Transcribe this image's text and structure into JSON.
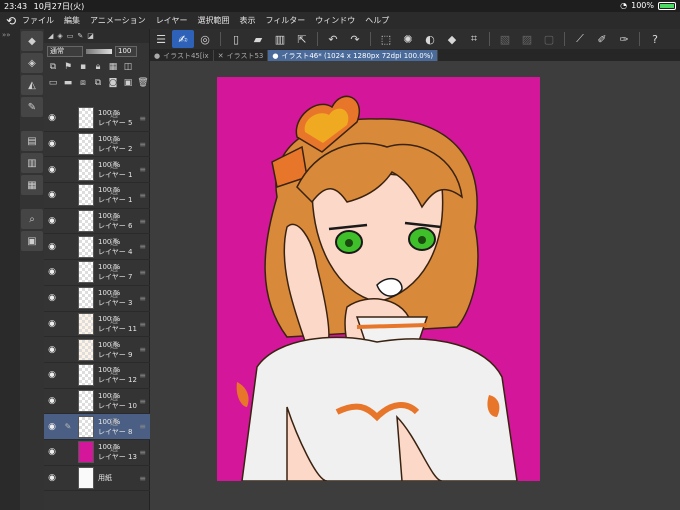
{
  "status": {
    "time": "23:43",
    "date": "10月27日(火)",
    "battery": "100%",
    "battery_level": 1.0
  },
  "menu": [
    "ファイル",
    "編集",
    "アニメーション",
    "レイヤー",
    "選択範囲",
    "表示",
    "フィルター",
    "ウィンドウ",
    "ヘルプ"
  ],
  "tabs": [
    {
      "label": "イラスト45[ix"
    },
    {
      "label": "イラスト53"
    },
    {
      "label": "イラスト46* (1024 x 1280px 72dpi 100.0%)"
    }
  ],
  "layer_panel": {
    "blend_mode": "通常",
    "opacity_value": "100"
  },
  "layers": [
    {
      "opacity": "100 %",
      "mode": "通",
      "name": "レイヤー 5"
    },
    {
      "opacity": "100 %",
      "mode": "通",
      "name": "レイヤー 2"
    },
    {
      "opacity": "100 %",
      "mode": "通",
      "name": "レイヤー 1"
    },
    {
      "opacity": "100 %",
      "mode": "通",
      "name": "レイヤー 1"
    },
    {
      "opacity": "100 %",
      "mode": "通",
      "name": "レイヤー 6"
    },
    {
      "opacity": "100 %",
      "mode": "通",
      "name": "レイヤー 4"
    },
    {
      "opacity": "100 %",
      "mode": "通",
      "name": "レイヤー 7"
    },
    {
      "opacity": "100 %",
      "mode": "通",
      "name": "レイヤー 3"
    },
    {
      "opacity": "100 %",
      "mode": "通",
      "name": "レイヤー 11"
    },
    {
      "opacity": "100 %",
      "mode": "通",
      "name": "レイヤー 9"
    },
    {
      "opacity": "100 %",
      "mode": "通",
      "name": "レイヤー 12"
    },
    {
      "opacity": "100 %",
      "mode": "通",
      "name": "レイヤー 10"
    },
    {
      "opacity": "100 %",
      "mode": "通",
      "name": "レイヤー 8"
    },
    {
      "opacity": "100 %",
      "mode": "通",
      "name": "レイヤー 13"
    },
    {
      "opacity": "",
      "mode": "",
      "name": "用紙"
    }
  ],
  "colors": {
    "canvas_bg": "#d4169a",
    "accent": "#2d62b8",
    "hair": "#d88a3a",
    "eyes": "#3fbf2a"
  }
}
